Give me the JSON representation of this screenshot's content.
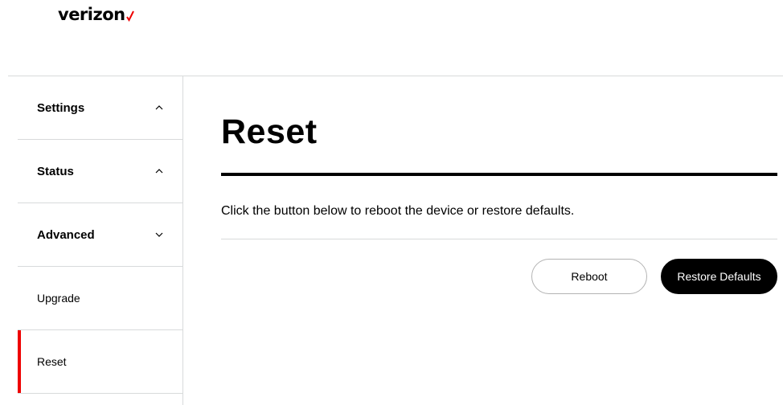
{
  "header": {
    "logo_text": "verizon",
    "logo_mark_color": "#ee0000",
    "brand_colors": {
      "accent": "#ee0000",
      "primary": "#000000",
      "divider": "#d8dadb"
    }
  },
  "sidebar": {
    "items": [
      {
        "label": "Settings",
        "expanded": true,
        "icon": "chevron-up-icon"
      },
      {
        "label": "Status",
        "expanded": true,
        "icon": "chevron-up-icon"
      },
      {
        "label": "Advanced",
        "expanded": false,
        "icon": "chevron-down-icon"
      },
      {
        "label": "Upgrade"
      },
      {
        "label": "Reset",
        "active": true
      }
    ]
  },
  "main": {
    "title": "Reset",
    "description": "Click the button below to reboot the device or restore defaults.",
    "buttons": {
      "reboot_label": "Reboot",
      "restore_label": "Restore Defaults"
    }
  }
}
